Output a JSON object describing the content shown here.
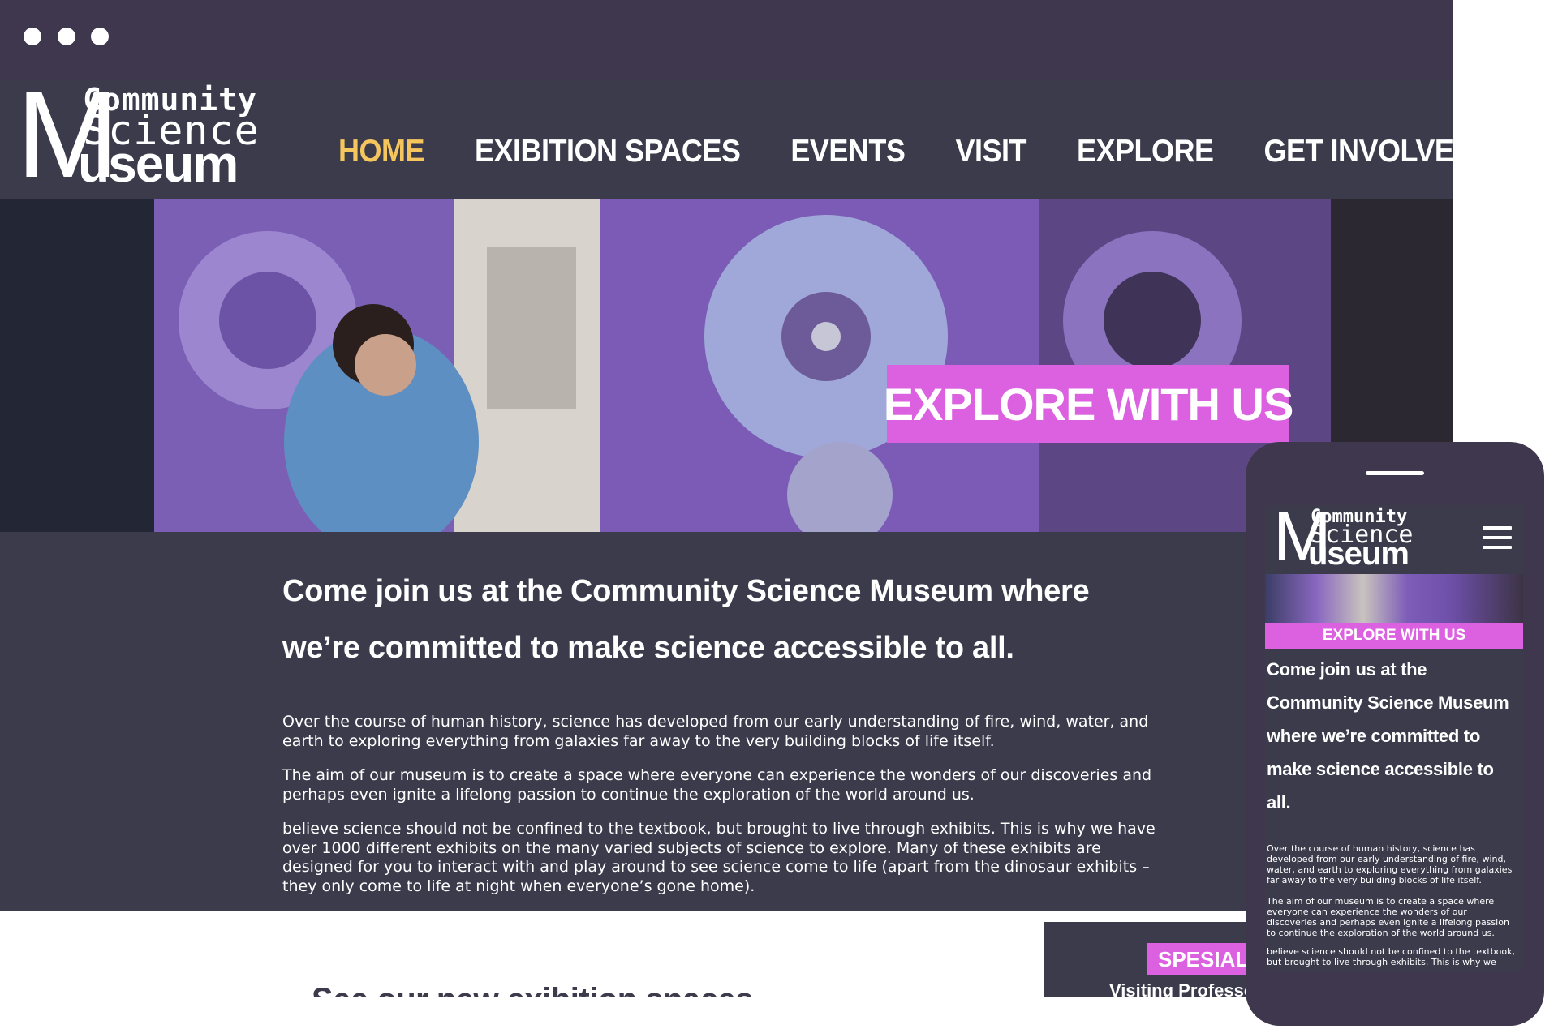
{
  "site": {
    "logo": {
      "line1": "Community",
      "line2": "Science",
      "line3": "useum",
      "initial": "M"
    },
    "nav": [
      {
        "label": "HOME",
        "active": true
      },
      {
        "label": "EXIBITION SPACES",
        "active": false
      },
      {
        "label": "EVENTS",
        "active": false
      },
      {
        "label": "VISIT",
        "active": false
      },
      {
        "label": "EXPLORE",
        "active": false
      },
      {
        "label": "GET INVOLVED",
        "active": false
      }
    ],
    "hero": {
      "title": "EXPLORE WITH US"
    },
    "intro": {
      "heading": "Come join us at the Community Science Museum where we’re committed to make science accessible to all.",
      "paragraphs": [
        "Over the course of human history, science has developed from our early understanding of fire, wind, water, and earth to exploring everything from galaxies far away to the very building blocks of life itself.",
        "The aim of our museum is to create a space where everyone can experience the wonders of our discoveries and perhaps even ignite a lifelong passion to continue the exploration of the world around us.",
        "believe science should not be confined to the textbook, but brought to live through exhibits. This is why we have over 1000 different exhibits on the many varied subjects of science to explore. Many of these exhibits are designed for you to interact with and play around to see science come to life (apart from the dinosaur exhibits – they only come to life at night when everyone’s gone home)."
      ]
    },
    "exhibition": {
      "heading": "See our new exibition spaces"
    },
    "special": {
      "badge": "SPESIAL I",
      "subtitle": "Visiting Professor o"
    }
  },
  "mobile": {
    "hero_title": "EXPLORE WITH US",
    "heading": "Come join us at the Community Science Museum where we’re committed to make science accessible to all.",
    "paragraphs": [
      "Over the course of human history, science has developed from our early understanding of fire, wind, water, and earth to exploring everything from galaxies far away to the very building blocks of life itself.",
      "The aim of our museum is to create a space where everyone can experience the wonders of our discoveries and perhaps even ignite a lifelong passion to continue the exploration of the world around us.",
      "believe science should not be confined to the textbook, but brought to live through exhibits. This is why we"
    ]
  },
  "colors": {
    "frame": "#3e374d",
    "header": "#3c3b4c",
    "accent_pink": "#dc61e0",
    "nav_active": "#f5c65d",
    "text": "#ffffff"
  },
  "icons": {
    "menu": "hamburger-icon",
    "window_controls": "window-dot-icon"
  }
}
